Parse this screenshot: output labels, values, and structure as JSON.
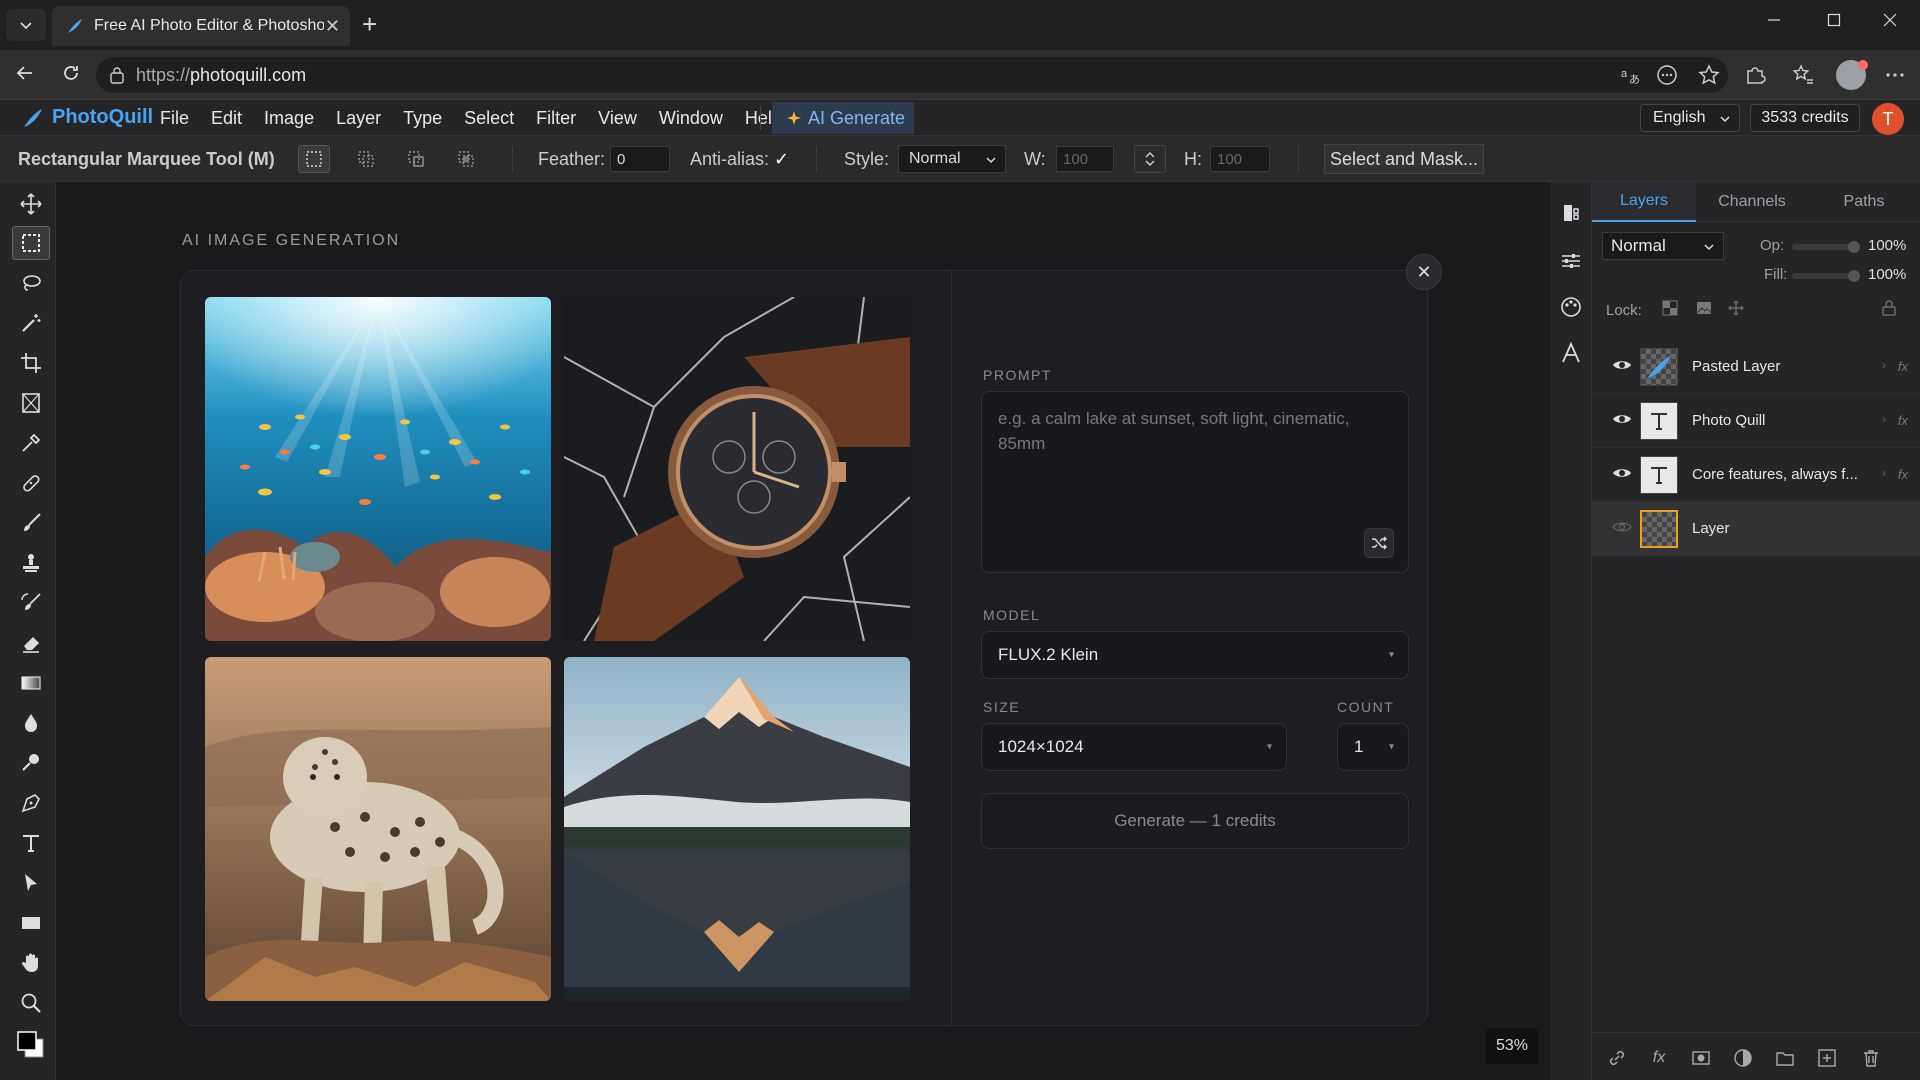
{
  "browser": {
    "tab_title": "Free AI Photo Editor & Photoshop",
    "tab_close": "✕",
    "new_tab": "+",
    "url_proto": "https://",
    "url_host": "photoquill.com"
  },
  "app": {
    "logo_text": "PhotoQuill",
    "menu": [
      "File",
      "Edit",
      "Image",
      "Layer",
      "Type",
      "Select",
      "Filter",
      "View",
      "Window",
      "Help"
    ],
    "ai_generate": "AI Generate",
    "language": "English",
    "credits": "3533 credits",
    "user_initial": "T",
    "accent": "#4aa3f0"
  },
  "options": {
    "tool_name": "Rectangular Marquee Tool (M)",
    "feather_label": "Feather:",
    "feather_value": "0",
    "antialias_label": "Anti-alias:",
    "antialias_check": "✓",
    "style_label": "Style:",
    "style_value": "Normal",
    "w_label": "W:",
    "w_value": "100",
    "h_label": "H:",
    "h_value": "100",
    "select_mask": "Select and Mask..."
  },
  "tools": [
    "move-tool",
    "marquee-tool",
    "lasso-tool",
    "magic-wand-tool",
    "crop-tool",
    "frame-tool",
    "eyedropper-tool",
    "healing-tool",
    "brush-tool",
    "stamp-tool",
    "history-brush-tool",
    "eraser-tool",
    "gradient-tool",
    "blur-tool",
    "dodge-tool",
    "pen-tool",
    "type-tool",
    "path-select-tool",
    "rectangle-tool",
    "hand-tool",
    "zoom-tool",
    "color-swatches"
  ],
  "generation": {
    "section_title": "AI IMAGE GENERATION",
    "close": "✕",
    "images": [
      "underwater coral reef with fish",
      "luxury wristwatch on marble",
      "snow leopard on rocks",
      "mountain reflected in misty lake"
    ],
    "prompt_label": "PROMPT",
    "prompt_placeholder": "e.g. a calm lake at sunset, soft light, cinematic, 85mm",
    "model_label": "MODEL",
    "model_value": "FLUX.2 Klein",
    "size_label": "SIZE",
    "size_value": "1024×1024",
    "count_label": "COUNT",
    "count_value": "1",
    "generate_label": "Generate — 1 credits"
  },
  "zoom": "53%",
  "layers_panel": {
    "tabs": [
      "Layers",
      "Channels",
      "Paths"
    ],
    "blend_mode": "Normal",
    "opacity_label": "Op:",
    "opacity_value": "100%",
    "fill_label": "Fill:",
    "fill_value": "100%",
    "lock_label": "Lock:",
    "layers": [
      {
        "name": "Pasted Layer",
        "fx": "fx"
      },
      {
        "name": "Photo Quill",
        "fx": "fx"
      },
      {
        "name": "Core features, always f...",
        "fx": "fx"
      },
      {
        "name": "Layer",
        "fx": ""
      }
    ]
  }
}
